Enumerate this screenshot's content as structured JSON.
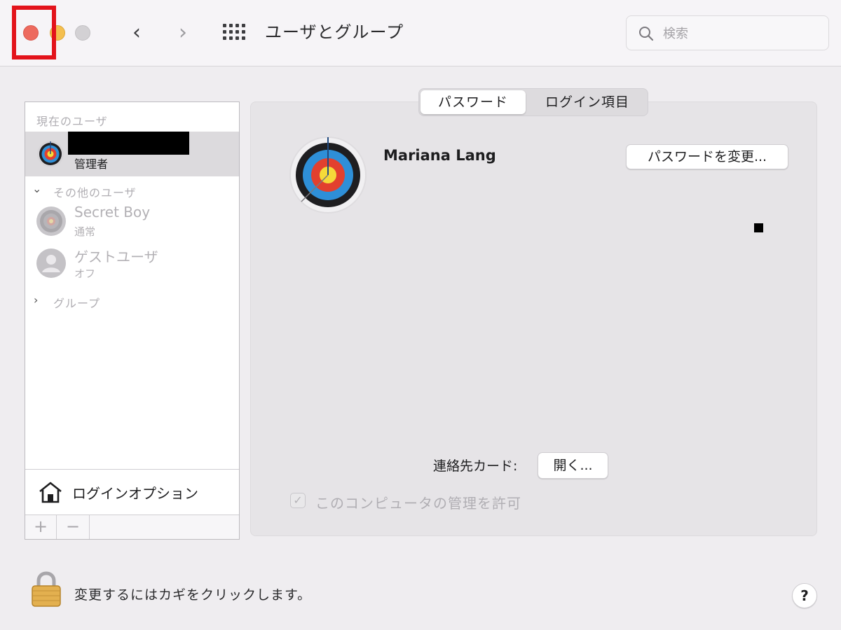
{
  "window": {
    "title": "ユーザとグループ",
    "back_glyph": "‹",
    "forward_glyph": "›",
    "grid_icon": "grid-icon",
    "search_placeholder": "検索"
  },
  "sidebar": {
    "current_users_label": "現在のユーザ",
    "current_user": {
      "role": "管理者"
    },
    "other_users_label": "その他のユーザ",
    "other_users": [
      {
        "name": "Secret Boy",
        "status": "通常"
      },
      {
        "name": "ゲストユーザ",
        "status": "オフ"
      }
    ],
    "groups_label": "グループ",
    "login_options_label": "ログインオプション",
    "add_label": "+",
    "remove_label": "−"
  },
  "tabs": [
    {
      "label": "パスワード",
      "active": true
    },
    {
      "label": "ログイン項目",
      "active": false
    }
  ],
  "main": {
    "user_name": "Mariana Lang",
    "change_password_label": "パスワードを変更...",
    "contact_card_label": "連絡先カード:",
    "open_button_label": "開く...",
    "allow_admin_label": "このコンピュータの管理を許可",
    "allow_admin_checked": true
  },
  "footer": {
    "lock_text": "変更するにはカギをクリックします。",
    "help_label": "?"
  },
  "colors": {
    "close": "#ed6a5e",
    "minimize": "#f4bf4f",
    "highlight": "#e3131b"
  }
}
